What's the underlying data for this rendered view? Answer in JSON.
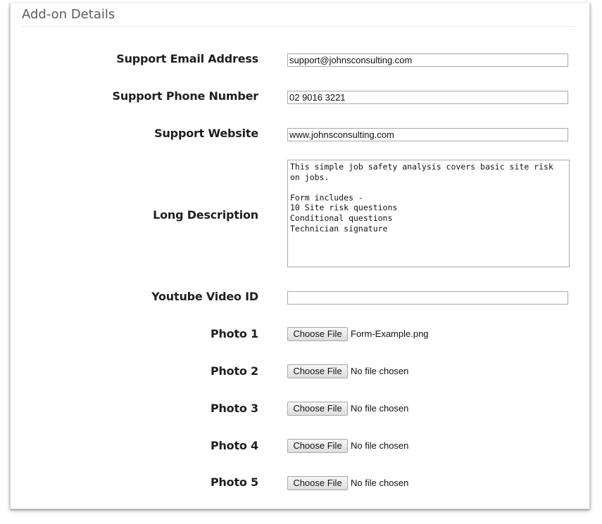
{
  "panel": {
    "title": "Add-on Details"
  },
  "form": {
    "support_email": {
      "label": "Support Email Address",
      "value": "support@johnsconsulting.com"
    },
    "support_phone": {
      "label": "Support Phone Number",
      "value": "02 9016 3221"
    },
    "support_website": {
      "label": "Support Website",
      "value": "www.johnsconsulting.com"
    },
    "long_description": {
      "label": "Long Description",
      "value": "This simple job safety analysis covers basic site risk on jobs.\n\nForm includes -\n10 Site risk questions\nConditional questions\nTechnician signature"
    },
    "youtube_video_id": {
      "label": "Youtube Video ID",
      "value": ""
    },
    "photos": [
      {
        "label": "Photo 1",
        "button": "Choose File",
        "file": "Form-Example.png"
      },
      {
        "label": "Photo 2",
        "button": "Choose File",
        "file": "No file chosen"
      },
      {
        "label": "Photo 3",
        "button": "Choose File",
        "file": "No file chosen"
      },
      {
        "label": "Photo 4",
        "button": "Choose File",
        "file": "No file chosen"
      },
      {
        "label": "Photo 5",
        "button": "Choose File",
        "file": "No file chosen"
      }
    ]
  }
}
